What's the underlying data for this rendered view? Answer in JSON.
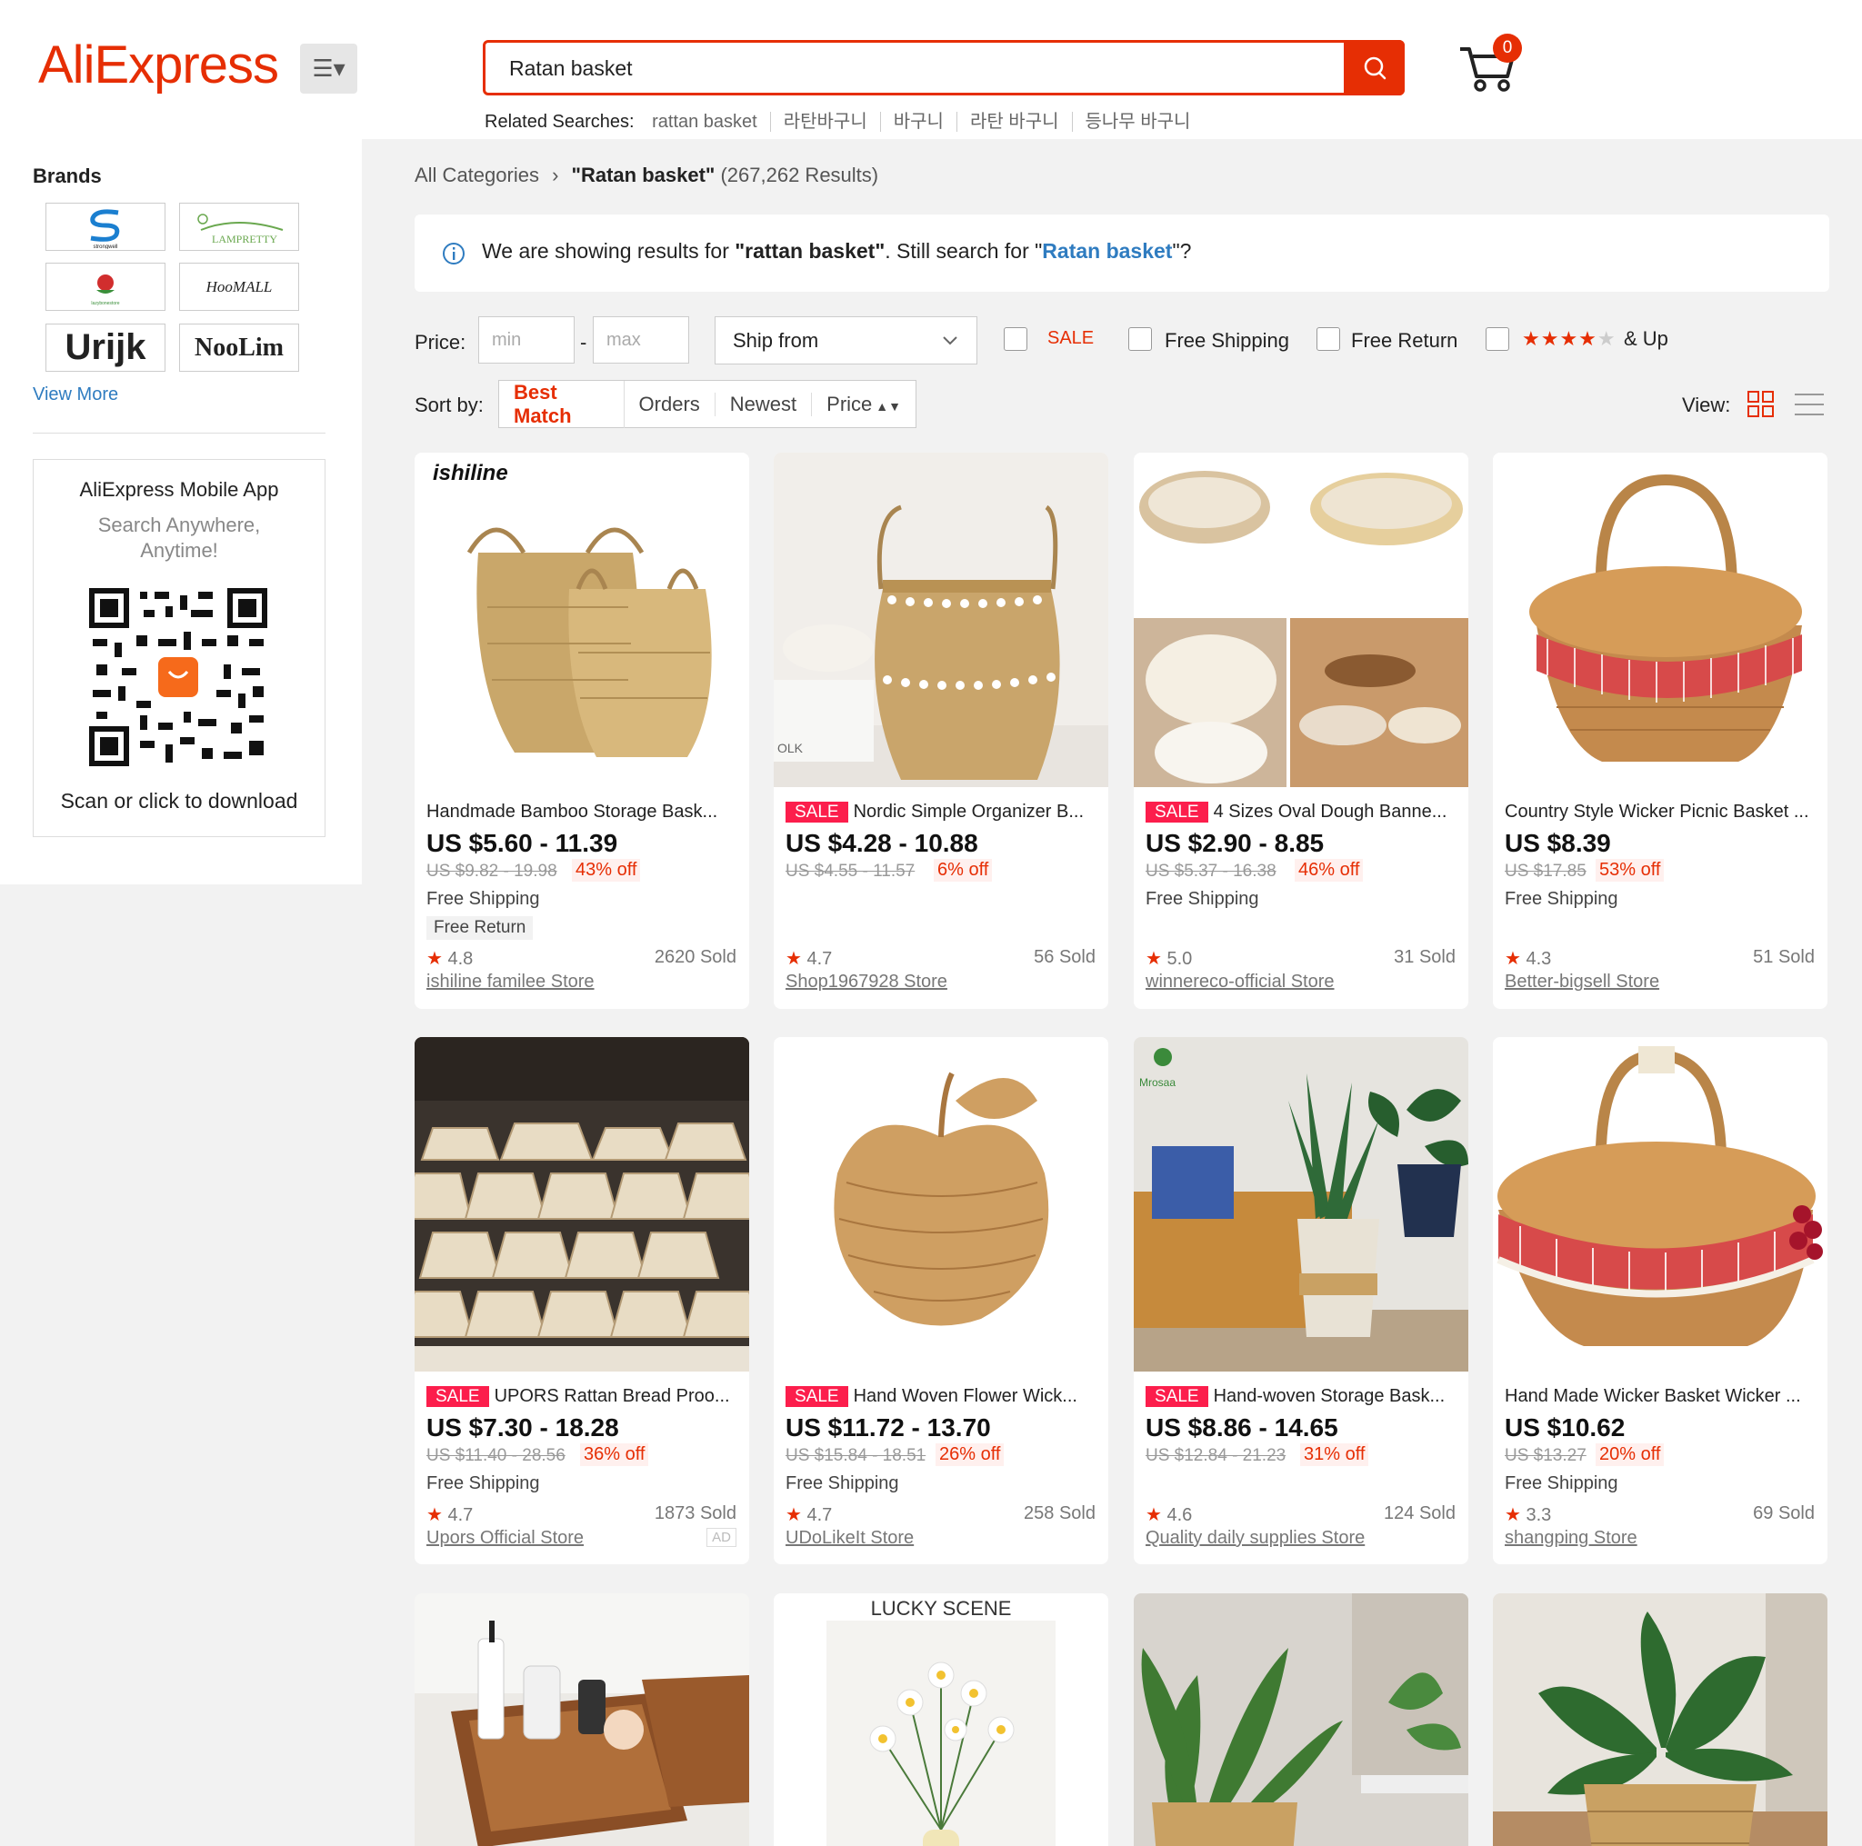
{
  "header": {
    "logo": "AliExpress",
    "search_value": "Ratan basket",
    "cart_count": "0",
    "related_label": "Related Searches:",
    "related": [
      "rattan basket",
      "라탄바구니",
      "바구니",
      "라탄 바구니",
      "등나무 바구니"
    ]
  },
  "sidebar": {
    "brands_title": "Brands",
    "brands": [
      "strongwell",
      "LAMPRETTY",
      "lazybonestore",
      "HooMALL",
      "Urijk",
      "NooLim"
    ],
    "view_more": "View More",
    "app_title": "AliExpress Mobile App",
    "app_sub1": "Search Anywhere,",
    "app_sub2": "Anytime!",
    "app_scan": "Scan or click to download"
  },
  "breadcrumb": {
    "root": "All Categories",
    "query": "\"Ratan basket\"",
    "results": "(267,262 Results)"
  },
  "notice": {
    "prefix": "We are showing results for",
    "shown": "\"rattan basket\"",
    "middle": ". Still search for",
    "alt_q1": "\"",
    "alt": "Ratan basket",
    "alt_q2": "\"?"
  },
  "filters": {
    "price_label": "Price:",
    "min_placeholder": "min",
    "max_placeholder": "max",
    "dash": "-",
    "ship_from": "Ship from",
    "sale": "SALE",
    "free_shipping": "Free Shipping",
    "free_return": "Free Return",
    "rating_up": "& Up"
  },
  "sort": {
    "label": "Sort by:",
    "options": [
      "Best Match",
      "Orders",
      "Newest",
      "Price"
    ],
    "view_label": "View:"
  },
  "colors": {
    "brand": "#e62e04",
    "sale": "#fc1e4c",
    "link": "#2f7cc0"
  },
  "products": [
    {
      "sale": false,
      "title": "Handmade Bamboo Storage Bask...",
      "price": "US $5.60 - 11.39",
      "orig": "US $9.82 - 19.98",
      "discount": "43% off",
      "shipping": "Free Shipping",
      "free_return": "Free Return",
      "rating": "4.8",
      "sold": "2620 Sold",
      "store": "ishiline familee Store",
      "brand_text": "ishiline"
    },
    {
      "sale": true,
      "title": "Nordic Simple Organizer B...",
      "price": "US $4.28 - 10.88",
      "orig": "US $4.55 - 11.57",
      "discount": "6% off",
      "shipping": "",
      "rating": "4.7",
      "sold": "56 Sold",
      "store": "Shop1967928 Store",
      "brand_text": "OLK"
    },
    {
      "sale": true,
      "title": "4 Sizes Oval Dough Banne...",
      "price": "US $2.90 - 8.85",
      "orig": "US $5.37 - 16.38",
      "discount": "46% off",
      "shipping": "Free Shipping",
      "rating": "5.0",
      "sold": "31 Sold",
      "store": "winnereco-official Store"
    },
    {
      "sale": false,
      "title": "Country Style Wicker Picnic Basket ...",
      "price": "US $8.39",
      "orig": "US $17.85",
      "discount": "53% off",
      "shipping": "Free Shipping",
      "rating": "4.3",
      "sold": "51 Sold",
      "store": "Better-bigsell Store"
    },
    {
      "sale": true,
      "title": "UPORS Rattan Bread Proo...",
      "price": "US $7.30 - 18.28",
      "orig": "US $11.40 - 28.56",
      "discount": "36% off",
      "shipping": "Free Shipping",
      "rating": "4.7",
      "sold": "1873 Sold",
      "store": "Upors Official Store",
      "ad": "AD"
    },
    {
      "sale": true,
      "title": "Hand Woven Flower Wick...",
      "price": "US $11.72 - 13.70",
      "orig": "US $15.84 - 18.51",
      "discount": "26% off",
      "shipping": "Free Shipping",
      "rating": "4.7",
      "sold": "258 Sold",
      "store": "UDoLikeIt Store"
    },
    {
      "sale": true,
      "title": "Hand-woven Storage Bask...",
      "price": "US $8.86 - 14.65",
      "orig": "US $12.84 - 21.23",
      "discount": "31% off",
      "shipping": "",
      "rating": "4.6",
      "sold": "124 Sold",
      "store": "Quality daily supplies Store",
      "brand_text": "Mrosaa"
    },
    {
      "sale": false,
      "title": "Hand Made Wicker Basket Wicker ...",
      "price": "US $10.62",
      "orig": "US $13.27",
      "discount": "20% off",
      "shipping": "Free Shipping",
      "rating": "3.3",
      "sold": "69 Sold",
      "store": "shangping Store"
    }
  ],
  "row3_brand_text": "LUCKY SCENE",
  "sale_tag": "SALE",
  "star": "★"
}
